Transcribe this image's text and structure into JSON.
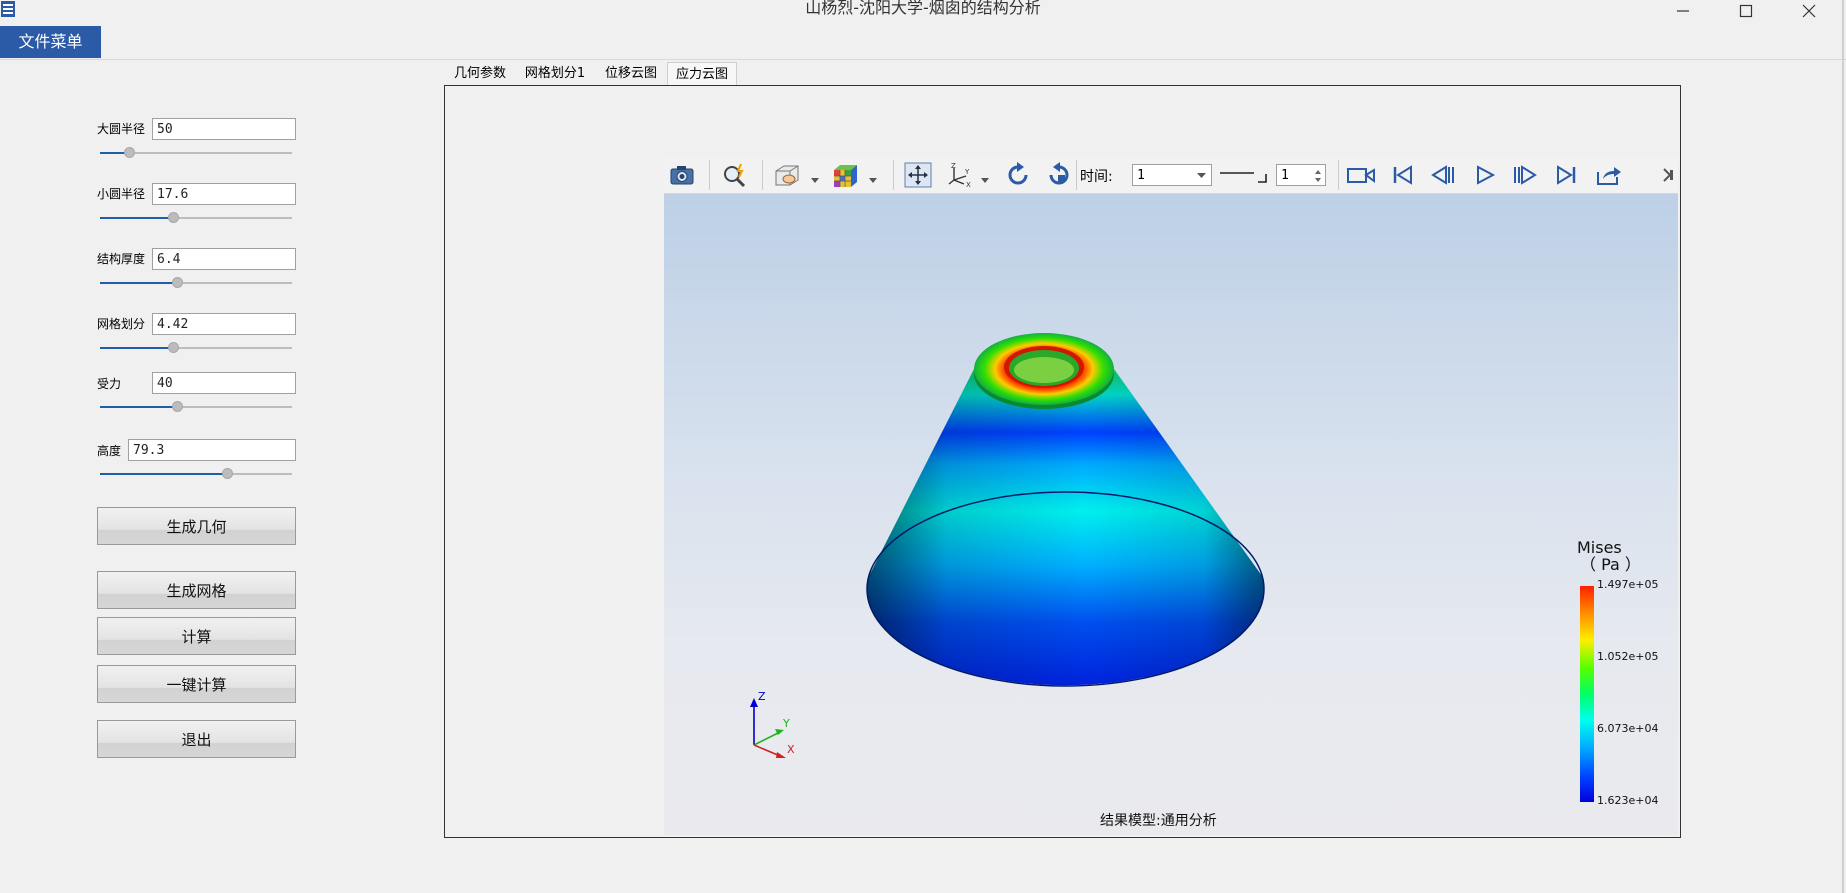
{
  "window": {
    "title": "山杨烈-沈阳大学-烟囱的结构分析"
  },
  "menu": {
    "file_menu_label": "文件菜单"
  },
  "params": [
    {
      "label": "大圆半径",
      "value": "50",
      "slider_fraction": 0.15
    },
    {
      "label": "小圆半径",
      "value": "17.6",
      "slider_fraction": 0.38
    },
    {
      "label": "结构厚度",
      "value": "6.4",
      "slider_fraction": 0.4
    },
    {
      "label": "网格划分",
      "value": "4.42",
      "slider_fraction": 0.38
    },
    {
      "label": "受力",
      "value": "40",
      "slider_fraction": 0.4
    },
    {
      "label": "高度",
      "value": "79.3",
      "slider_fraction": 0.66
    }
  ],
  "actions": {
    "generate_geometry": "生成几何",
    "generate_mesh": "生成网格",
    "compute": "计算",
    "one_click_compute": "一键计算",
    "exit": "退出"
  },
  "tabs": [
    {
      "label": "几何参数",
      "active": false
    },
    {
      "label": "网格划分1",
      "active": false
    },
    {
      "label": "位移云图",
      "active": false
    },
    {
      "label": "应力云图",
      "active": true
    }
  ],
  "toolbar": {
    "time_label": "时间:",
    "time_value": "1",
    "frame_value": "1",
    "icons": [
      "camera-icon",
      "zoom-fit-icon",
      "display-mode-icon",
      "color-cube-icon",
      "pan-icon",
      "axes-icon",
      "rotate-cw-icon",
      "rotate-ccw-icon",
      "record-icon",
      "first-frame-icon",
      "prev-frame-icon",
      "play-icon",
      "next-frame-icon",
      "last-frame-icon",
      "export-icon"
    ]
  },
  "legend": {
    "title": "Mises",
    "unit": "（ Pa ）",
    "ticks": [
      "1.497e+05",
      "1.052e+05",
      "6.073e+04",
      "1.623e+04"
    ],
    "colors": [
      "#ff2000",
      "#ffee00",
      "#00ff66",
      "#00ffee",
      "#0000dd"
    ]
  },
  "axes_triad": {
    "x": "X",
    "y": "Y",
    "z": "Z"
  },
  "model_label": "结果模型:通用分析"
}
